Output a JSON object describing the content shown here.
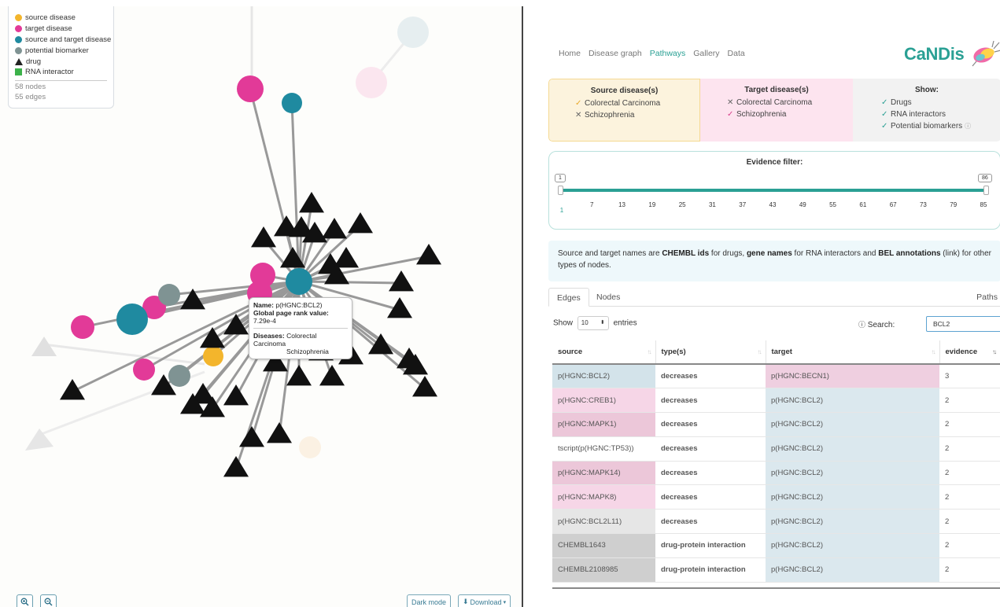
{
  "legend": {
    "items": [
      {
        "label": "source disease",
        "color": "#f3b52c",
        "shape": "circle"
      },
      {
        "label": "target disease",
        "color": "#e23a98",
        "shape": "circle"
      },
      {
        "label": "source and target disease",
        "color": "#1f8aa0",
        "shape": "circle"
      },
      {
        "label": "potential biomarker",
        "color": "#7f9393",
        "shape": "circle"
      },
      {
        "label": "drug",
        "color": "#222222",
        "shape": "triangle"
      },
      {
        "label": "RNA interactor",
        "color": "#3cb24a",
        "shape": "square"
      }
    ],
    "nodes": "58 nodes",
    "edges": "55 edges"
  },
  "tooltip": {
    "name_label": "Name:",
    "name_value": "p(HGNC:BCL2)",
    "rank_label": "Global page rank value:",
    "rank_value": "7.29e-4",
    "diseases_label": "Diseases:",
    "disease_1": "Colorectal Carcinoma",
    "disease_2": "Schizophrenia"
  },
  "graph_controls": {
    "zoom_in_icon": "zoom-in-icon",
    "zoom_out_icon": "zoom-out-icon",
    "dark_mode": "Dark mode",
    "download": "Download"
  },
  "nav": {
    "items": [
      "Home",
      "Disease graph",
      "Pathways",
      "Gallery",
      "Data"
    ],
    "active": "Pathways"
  },
  "brand": "CaNDis",
  "diseases": {
    "source_title": "Source disease(s)",
    "source_items": [
      {
        "mark": "✓",
        "label": "Colorectal Carcinoma"
      },
      {
        "mark": "✕",
        "label": "Schizophrenia"
      }
    ],
    "target_title": "Target disease(s)",
    "target_items": [
      {
        "mark": "✕",
        "label": "Colorectal Carcinoma"
      },
      {
        "mark": "✓",
        "label": "Schizophrenia"
      }
    ],
    "show_title": "Show:",
    "show_items": [
      {
        "mark": "✓",
        "label": "Drugs"
      },
      {
        "mark": "✓",
        "label": "RNA interactors"
      },
      {
        "mark": "✓",
        "label": "Potential biomarkers"
      }
    ]
  },
  "evidence": {
    "title": "Evidence filter:",
    "min_value": "1",
    "max_value": "86",
    "ticks": [
      "1",
      "7",
      "13",
      "19",
      "25",
      "31",
      "37",
      "43",
      "49",
      "55",
      "61",
      "67",
      "73",
      "79",
      "85"
    ]
  },
  "info": {
    "t1": "Source and target names are ",
    "b1": "CHEMBL ids",
    "t2": " for drugs, ",
    "b2": "gene names",
    "t3": " for RNA interactors and ",
    "b3": "BEL annotations",
    "t4": " (link) for other types of nodes."
  },
  "tabs": {
    "edges": "Edges",
    "nodes": "Nodes",
    "paths": "Paths"
  },
  "controls": {
    "show_label": "Show",
    "show_value": "10",
    "entries_label": "entries",
    "search_label": "Search:",
    "search_value": "BCL2"
  },
  "table": {
    "headers": [
      "source",
      "type(s)",
      "target",
      "evidence"
    ],
    "rows": [
      {
        "source": "p(HGNC:BCL2)",
        "type": "decreases",
        "target": "p(HGNC:BECN1)",
        "evidence": "3"
      },
      {
        "source": "p(HGNC:CREB1)",
        "type": "decreases",
        "target": "p(HGNC:BCL2)",
        "evidence": "2"
      },
      {
        "source": "p(HGNC:MAPK1)",
        "type": "decreases",
        "target": "p(HGNC:BCL2)",
        "evidence": "2"
      },
      {
        "source": "tscript(p(HGNC:TP53))",
        "type": "decreases",
        "target": "p(HGNC:BCL2)",
        "evidence": "2"
      },
      {
        "source": "p(HGNC:MAPK14)",
        "type": "decreases",
        "target": "p(HGNC:BCL2)",
        "evidence": "2"
      },
      {
        "source": "p(HGNC:MAPK8)",
        "type": "decreases",
        "target": "p(HGNC:BCL2)",
        "evidence": "2"
      },
      {
        "source": "p(HGNC:BCL2L11)",
        "type": "decreases",
        "target": "p(HGNC:BCL2)",
        "evidence": "2"
      },
      {
        "source": "CHEMBL1643",
        "type": "drug-protein interaction",
        "target": "p(HGNC:BCL2)",
        "evidence": "2"
      },
      {
        "source": "CHEMBL2108985",
        "type": "drug-protein interaction",
        "target": "p(HGNC:BCL2)",
        "evidence": "2"
      }
    ]
  }
}
